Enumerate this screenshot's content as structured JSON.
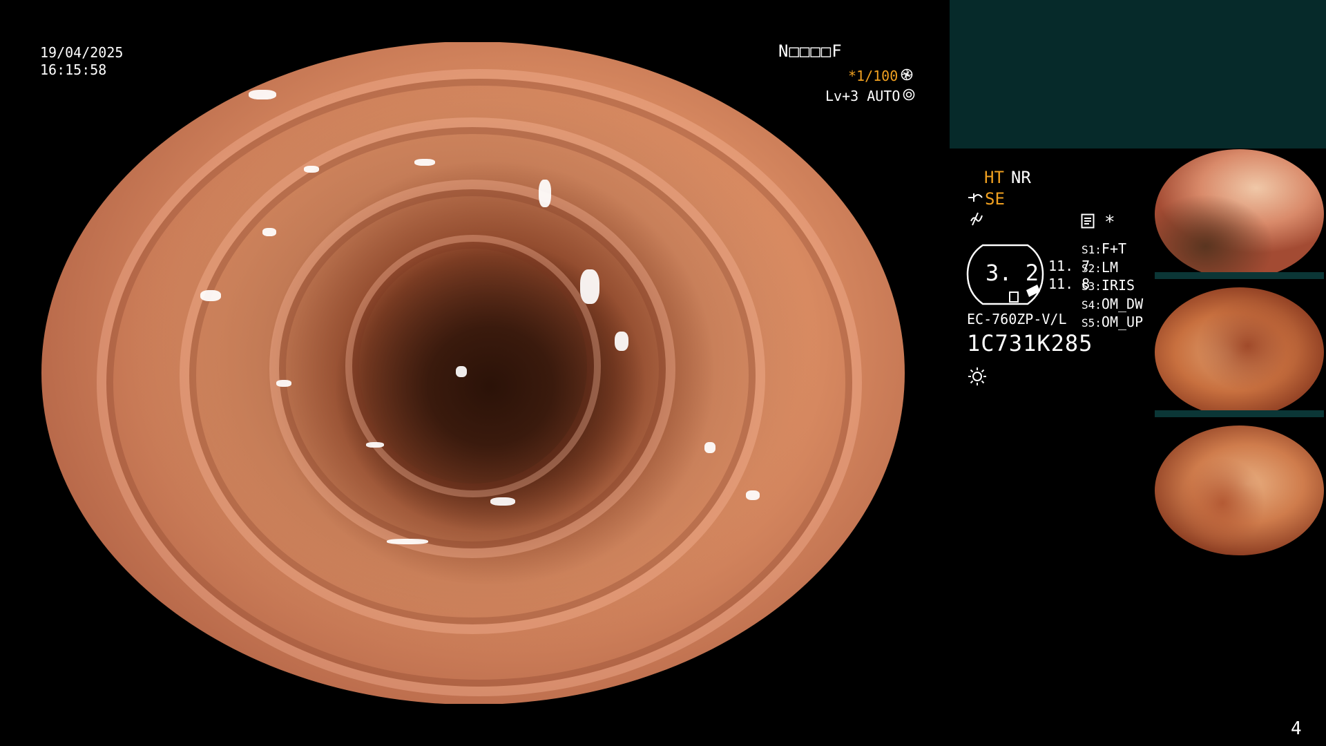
{
  "overlay": {
    "date": "19/04/2025",
    "time": "16:15:58",
    "id_code": "N□□□□F",
    "shutter": "*1/100",
    "level": "Lv+3 AUTO"
  },
  "settings": {
    "ht": "HT",
    "nr": "NR",
    "se": "SE",
    "star": "*",
    "magnification": "3. 2",
    "val_top": "11. 7",
    "val_bottom": "11. 8",
    "scope_model": "EC-760ZP-V/L",
    "serial": "1C731K285",
    "s_buttons": [
      {
        "key": "S1",
        "value": "F+T"
      },
      {
        "key": "S2",
        "value": "LM"
      },
      {
        "key": "S3",
        "value": "IRIS"
      },
      {
        "key": "S4",
        "value": "OM_DW"
      },
      {
        "key": "S5",
        "value": "OM_UP"
      }
    ]
  },
  "thumbnails": {
    "count": "4"
  },
  "icons": {
    "shutter_icon": "aperture-icon",
    "auto_icon": "iris-icon",
    "light_icon": "sun-icon",
    "se_icon": "structure-icon",
    "color_icon": "color-enhance-icon",
    "record_icon": "memo-icon"
  }
}
